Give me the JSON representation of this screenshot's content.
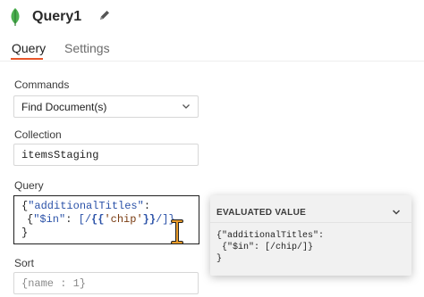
{
  "header": {
    "title": "Query1",
    "icons": {
      "logo": "leaf-icon",
      "edit": "pencil-icon"
    }
  },
  "tabs": [
    {
      "label": "Query",
      "active": true
    },
    {
      "label": "Settings",
      "active": false
    }
  ],
  "form": {
    "commands": {
      "label": "Commands",
      "value": "Find Document(s)"
    },
    "collection": {
      "label": "Collection",
      "value": "itemsStaging"
    },
    "query": {
      "label": "Query",
      "line1": {
        "brace": "{",
        "key": "\"additionalTitles\"",
        "colon": ":"
      },
      "line2": {
        "key": "\"$in\"",
        "colon": ":",
        "open": "[/",
        "curly_open": "{{",
        "chip": "'chip'",
        "curly_close": "}}",
        "close": "/]}"
      },
      "line3": "}"
    },
    "sort": {
      "label": "Sort",
      "placeholder": "{name : 1}"
    }
  },
  "evaluated": {
    "title": "EVALUATED VALUE",
    "lines": [
      "{\"additionalTitles\":",
      " {\"$in\": [/chip/]}",
      "}"
    ]
  },
  "colors": {
    "accent": "#e8562a",
    "logo": "#4caf50",
    "code_key": "#2b52a8",
    "code_string": "#7a3c12",
    "cursor": "#e89b2a"
  }
}
